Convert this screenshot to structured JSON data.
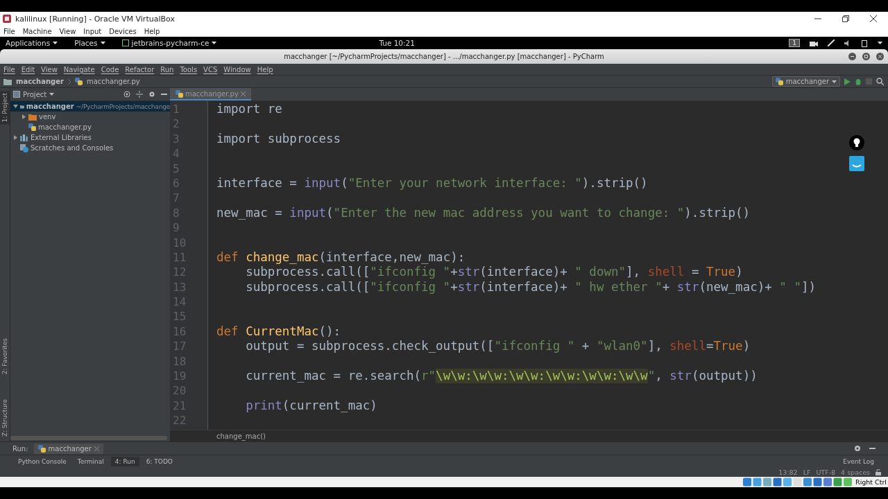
{
  "vbox": {
    "title": "kalilinux [Running] - Oracle VM VirtualBox",
    "menu": [
      "File",
      "Machine",
      "View",
      "Input",
      "Devices",
      "Help"
    ],
    "host_key": "Right Ctrl"
  },
  "gnome_bar": {
    "menus": [
      "Applications",
      "Places",
      "jetbrains-pycharm-ce"
    ],
    "clock": "Tue 10:21",
    "workspace": "1"
  },
  "window": {
    "title": "macchanger [~/PycharmProjects/macchanger] - .../macchanger.py [macchanger] - PyCharm"
  },
  "menu": [
    "File",
    "Edit",
    "View",
    "Navigate",
    "Code",
    "Refactor",
    "Run",
    "Tools",
    "VCS",
    "Window",
    "Help"
  ],
  "breadcrumb": [
    "macchanger",
    "macchanger.py"
  ],
  "run_config": "macchanger",
  "side_tabs": [
    {
      "label": "1: Project",
      "selected": true
    },
    {
      "label": "2: Favorites",
      "selected": false
    },
    {
      "label": "Z: Structure",
      "selected": false
    }
  ],
  "project": {
    "title": "Project",
    "tree": [
      {
        "label": "macchanger",
        "path": "~/PycharmProjects/macchange",
        "kind": "folder",
        "expanded": true,
        "selected": true,
        "children": [
          {
            "label": "venv",
            "kind": "venv",
            "expanded": false,
            "selected": false
          },
          {
            "label": "macchanger.py",
            "kind": "file",
            "selected": false
          }
        ]
      },
      {
        "label": "External Libraries",
        "kind": "library",
        "expanded": false,
        "selected": false
      },
      {
        "label": "Scratches and Consoles",
        "kind": "scratch",
        "selected": false
      }
    ]
  },
  "editor_tab": "macchanger.py",
  "code": [
    {
      "n": "1",
      "tokens": [
        {
          "text": "import re",
          "kind": "plain"
        }
      ]
    },
    {
      "n": "2"
    },
    {
      "n": "3",
      "tokens": [
        {
          "text": "import subprocess",
          "kind": "plain"
        }
      ]
    },
    {
      "n": "4"
    },
    {
      "n": "5"
    },
    {
      "n": "6",
      "tokens": [
        {
          "text": "interface = ",
          "kind": "plain"
        },
        {
          "text": "input",
          "kind": "builtin"
        },
        {
          "text": "(",
          "kind": "plain"
        },
        {
          "text": "\"Enter your network interface: \"",
          "kind": "string"
        },
        {
          "text": ").strip()",
          "kind": "plain"
        }
      ]
    },
    {
      "n": "7"
    },
    {
      "n": "8",
      "tokens": [
        {
          "text": "new_mac = ",
          "kind": "plain"
        },
        {
          "text": "input",
          "kind": "builtin"
        },
        {
          "text": "(",
          "kind": "plain"
        },
        {
          "text": "\"Enter the new mac address you want to change: \"",
          "kind": "string"
        },
        {
          "text": ").strip()",
          "kind": "plain"
        }
      ]
    },
    {
      "n": "9"
    },
    {
      "n": "10"
    },
    {
      "n": "11",
      "tokens": [
        {
          "text": "def ",
          "kind": "keyword"
        },
        {
          "text": "change_mac",
          "kind": "function"
        },
        {
          "text": "(interface,new_mac):",
          "kind": "plain"
        }
      ]
    },
    {
      "n": "12",
      "indented": true,
      "tokens": [
        {
          "text": "subprocess.call([",
          "kind": "plain"
        },
        {
          "text": "\"ifconfig \"",
          "kind": "string"
        },
        {
          "text": "+",
          "kind": "plain"
        },
        {
          "text": "str",
          "kind": "builtin"
        },
        {
          "text": "(interface)+ ",
          "kind": "plain"
        },
        {
          "text": "\" down\"",
          "kind": "string"
        },
        {
          "text": "], ",
          "kind": "plain"
        },
        {
          "text": "shell",
          "kind": "kwarg"
        },
        {
          "text": " = ",
          "kind": "plain"
        },
        {
          "text": "True",
          "kind": "keyword"
        },
        {
          "text": ")",
          "kind": "plain"
        }
      ]
    },
    {
      "n": "13",
      "indented": true,
      "tokens": [
        {
          "text": "subprocess.call([",
          "kind": "plain"
        },
        {
          "text": "\"ifconfig \"",
          "kind": "string"
        },
        {
          "text": "+",
          "kind": "plain"
        },
        {
          "text": "str",
          "kind": "builtin"
        },
        {
          "text": "(interface)+ ",
          "kind": "plain"
        },
        {
          "text": "\" hw ether \"",
          "kind": "string"
        },
        {
          "text": "+ ",
          "kind": "plain"
        },
        {
          "text": "str",
          "kind": "builtin"
        },
        {
          "text": "(new_mac)+ ",
          "kind": "plain"
        },
        {
          "text": "\" \"",
          "kind": "string"
        },
        {
          "text": "])",
          "kind": "plain"
        }
      ]
    },
    {
      "n": "14"
    },
    {
      "n": "15"
    },
    {
      "n": "16",
      "tokens": [
        {
          "text": "def ",
          "kind": "keyword"
        },
        {
          "text": "CurrentMac",
          "kind": "function"
        },
        {
          "text": "():",
          "kind": "plain"
        }
      ]
    },
    {
      "n": "17",
      "indented": true,
      "tokens": [
        {
          "text": "output = subprocess.check_output([",
          "kind": "plain"
        },
        {
          "text": "\"ifconfig \"",
          "kind": "string"
        },
        {
          "text": " + ",
          "kind": "plain"
        },
        {
          "text": "\"wlan0\"",
          "kind": "string"
        },
        {
          "text": "], ",
          "kind": "plain"
        },
        {
          "text": "shell",
          "kind": "kwarg"
        },
        {
          "text": "=",
          "kind": "plain"
        },
        {
          "text": "True",
          "kind": "keyword"
        },
        {
          "text": ")",
          "kind": "plain"
        }
      ]
    },
    {
      "n": "18"
    },
    {
      "n": "19",
      "indented": true,
      "tokens": [
        {
          "text": "current_mac = re.search(",
          "kind": "plain"
        },
        {
          "text": "r\"",
          "kind": "string"
        },
        {
          "text": "\\w\\w:\\w\\w:\\w\\w:\\w\\w:\\w\\w:\\w\\w",
          "kind": "regex"
        },
        {
          "text": "\"",
          "kind": "string"
        },
        {
          "text": ", ",
          "kind": "plain"
        },
        {
          "text": "str",
          "kind": "builtin"
        },
        {
          "text": "(output))",
          "kind": "plain"
        }
      ]
    },
    {
      "n": "20"
    },
    {
      "n": "21",
      "indented": true,
      "tokens": [
        {
          "text": "print",
          "kind": "builtin"
        },
        {
          "text": "(current_mac)",
          "kind": "plain"
        }
      ]
    },
    {
      "n": "22"
    }
  ],
  "editor_breadcrumb": "change_mac()",
  "run_bar": {
    "label": "Run:",
    "tab": "macchanger"
  },
  "tool_tabs": [
    {
      "label": "Python Console",
      "selected": false
    },
    {
      "label": "Terminal",
      "selected": false
    },
    {
      "label": "4: Run",
      "selected": true
    },
    {
      "label": "6: TODO",
      "selected": false
    }
  ],
  "event_log": "Event Log",
  "status": {
    "position": "13:82",
    "line_sep": "LF",
    "encoding": "UTF-8",
    "indent": "4 spaces"
  }
}
